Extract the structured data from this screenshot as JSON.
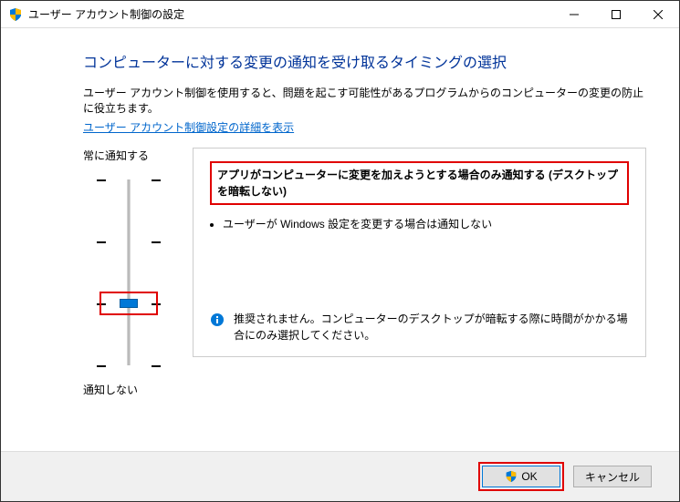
{
  "window": {
    "title": "ユーザー アカウント制御の設定"
  },
  "heading": "コンピューターに対する変更の通知を受け取るタイミングの選択",
  "description": "ユーザー アカウント制御を使用すると、問題を起こす可能性があるプログラムからのコンピューターの変更の防止に役立ちます。",
  "link": "ユーザー アカウント制御設定の詳細を表示",
  "slider": {
    "top_label": "常に通知する",
    "bottom_label": "通知しない",
    "levels": 4,
    "current_level": 1
  },
  "panel": {
    "title": "アプリがコンピューターに変更を加えようとする場合のみ通知する (デスクトップを暗転しない)",
    "bullets": [
      "ユーザーが Windows 設定を変更する場合は通知しない"
    ],
    "note": "推奨されません。コンピューターのデスクトップが暗転する際に時間がかかる場合にのみ選択してください。"
  },
  "buttons": {
    "ok": "OK",
    "cancel": "キャンセル"
  },
  "colors": {
    "heading": "#003399",
    "link": "#0066cc",
    "accent": "#0078d7",
    "highlight_border": "#e00000"
  }
}
